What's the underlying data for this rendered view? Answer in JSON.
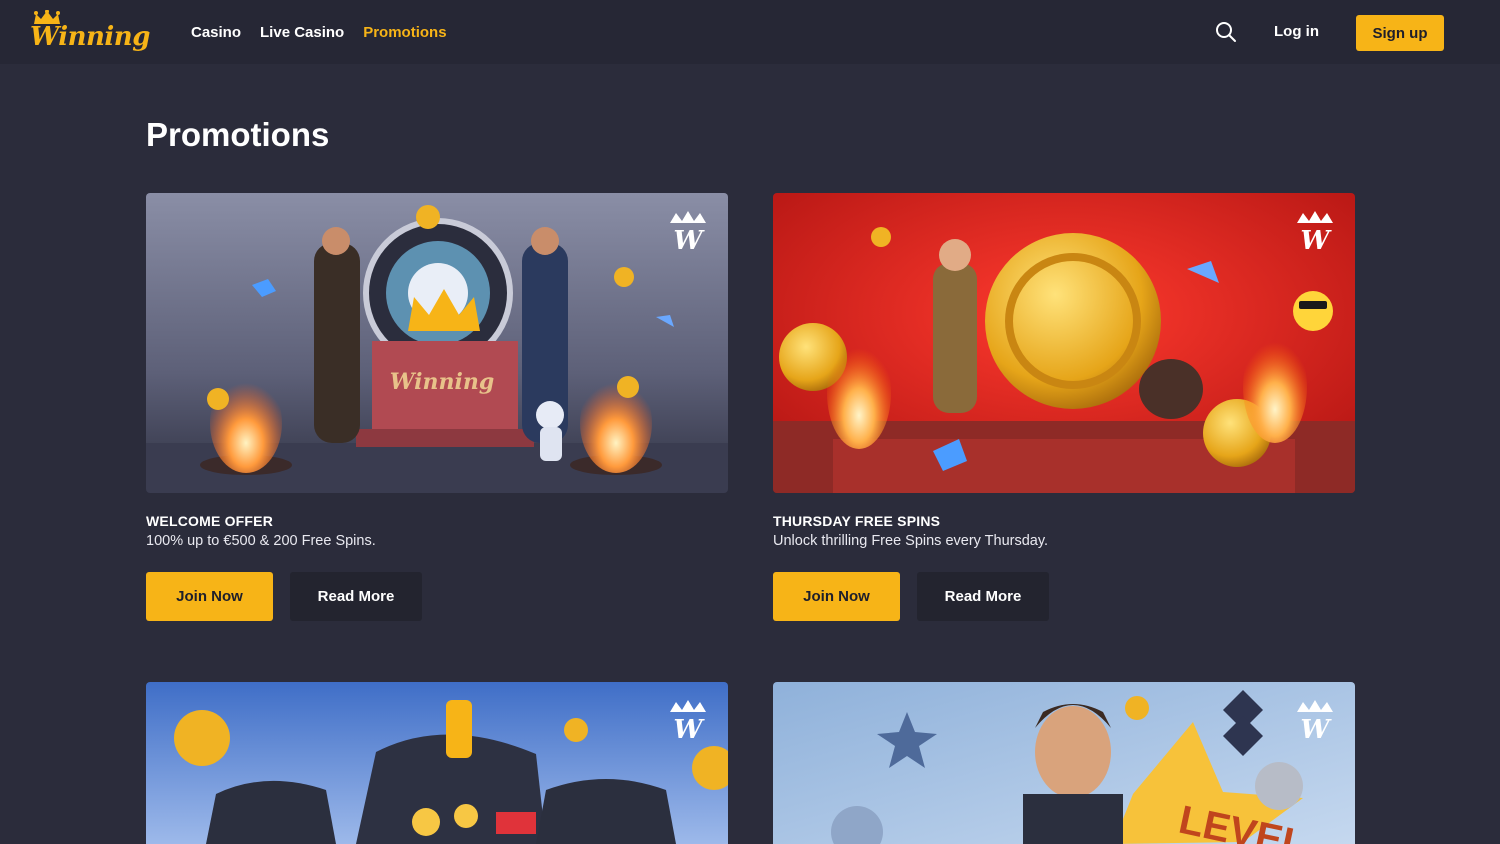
{
  "header": {
    "logo_text": "Winning",
    "nav": [
      {
        "label": "Casino",
        "active": false
      },
      {
        "label": "Live Casino",
        "active": false
      },
      {
        "label": "Promotions",
        "active": true
      }
    ],
    "search_icon": "search-icon",
    "login_label": "Log in",
    "signup_label": "Sign up"
  },
  "main": {
    "title": "Promotions",
    "cards": [
      {
        "title": "WELCOME OFFER",
        "description": "100% up to €500 & 200 Free Spins.",
        "join_label": "Join Now",
        "read_label": "Read More",
        "image": "welcome-offer-banner"
      },
      {
        "title": "THURSDAY FREE SPINS",
        "description": "Unlock thrilling Free Spins every Thursday.",
        "join_label": "Join Now",
        "read_label": "Read More",
        "image": "thursday-free-spins-banner"
      },
      {
        "title": "",
        "image": "treasure-chest-banner"
      },
      {
        "title": "",
        "image": "level-up-banner",
        "image_text": "LEVEL"
      }
    ]
  },
  "colors": {
    "accent": "#f7b417",
    "background": "#2b2c3b",
    "header": "#262735",
    "secondary_button": "#23242f"
  }
}
